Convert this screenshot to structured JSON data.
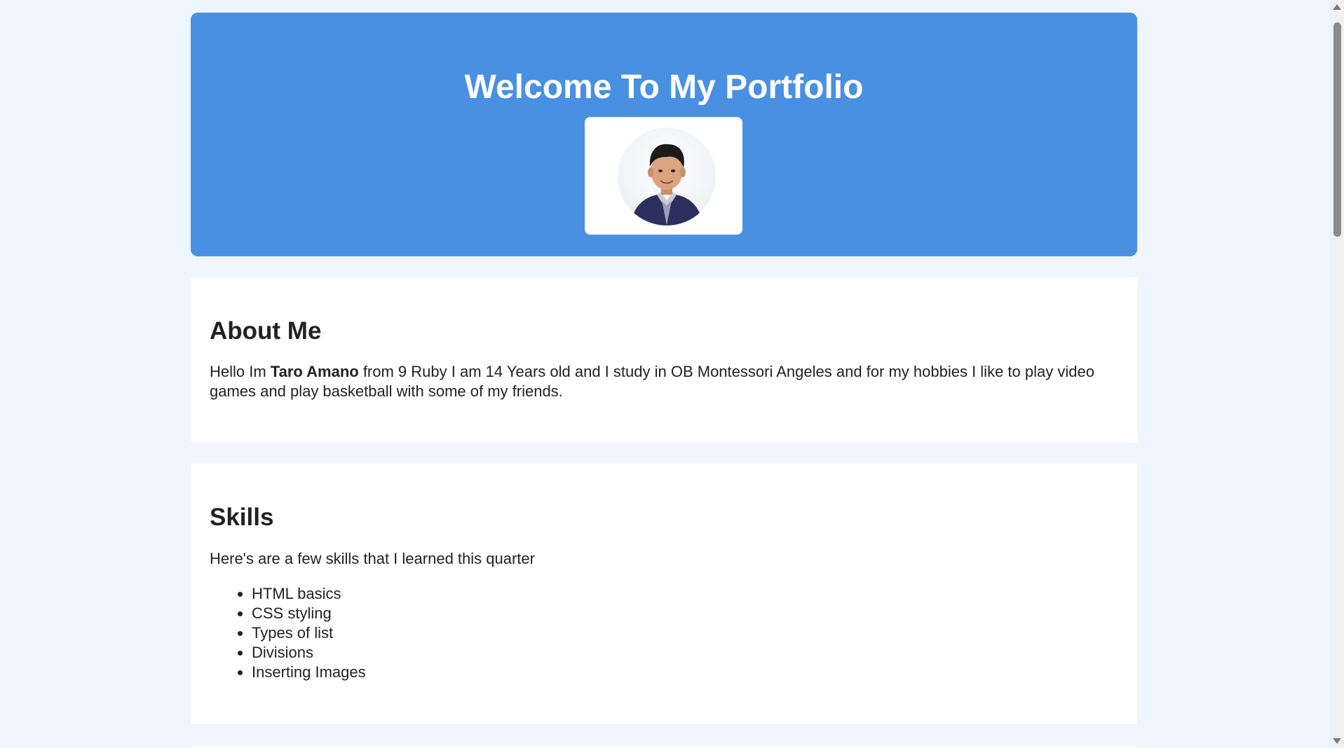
{
  "header": {
    "title": "Welcome To My Portfolio",
    "avatar_icon": "portrait-photo"
  },
  "about": {
    "heading": "About Me",
    "text_before": "Hello Im ",
    "name": "Taro Amano",
    "text_after": " from 9 Ruby I am 14 Years old and I study in OB Montessori Angeles and for my hobbies I like to play video games and play basketball with some of my friends."
  },
  "skills": {
    "heading": "Skills",
    "intro": "Here's are a few skills that I learned this quarter",
    "items": [
      "HTML basics",
      "CSS styling",
      "Types of list",
      "Divisions",
      "Inserting Images"
    ]
  },
  "colors": {
    "header_bg": "#4a90e2",
    "page_bg": "#f0f6fd",
    "card_bg": "#ffffff"
  }
}
